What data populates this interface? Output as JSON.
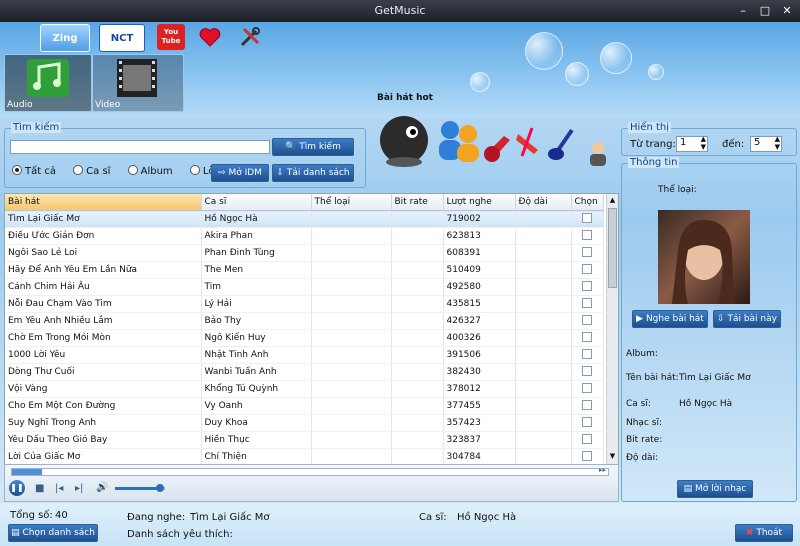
{
  "window": {
    "title": "GetMusic"
  },
  "topbar": {
    "source_tabs": [
      {
        "name": "zing",
        "label": "Zing"
      },
      {
        "name": "nct",
        "label": "NCT"
      },
      {
        "name": "youtube",
        "label": "You Tube"
      }
    ],
    "categories": [
      {
        "label": "Audio"
      },
      {
        "label": "Video"
      }
    ]
  },
  "hot": {
    "label": "Bài hát hot"
  },
  "search": {
    "group_label": "Tìm kiếm",
    "input_value": "",
    "search_button": "Tìm kiếm",
    "radios": [
      {
        "label": "Tất cả",
        "checked": true
      },
      {
        "label": "Ca sĩ",
        "checked": false
      },
      {
        "label": "Album",
        "checked": false
      },
      {
        "label": "Lời",
        "checked": false
      }
    ],
    "open_idm_button": "Mở IDM",
    "download_list_button": "Tải danh sách"
  },
  "display": {
    "group_label": "Hiển thị",
    "from_page_label": "Từ trang:",
    "from_page_value": "1",
    "to_label": "đến:",
    "to_value": "5"
  },
  "table": {
    "columns": [
      "Bài hát",
      "Ca sĩ",
      "Thể loại",
      "Bit rate",
      "Lượt nghe",
      "Độ dài",
      "Chọn"
    ],
    "rows": [
      [
        "Tìm Lại Giấc Mơ",
        "Hồ Ngọc Hà",
        "",
        "",
        "719002",
        ""
      ],
      [
        "Điều Ước Giản Đơn",
        "Akira Phan",
        "",
        "",
        "623813",
        ""
      ],
      [
        "Ngôi Sao Lẻ Loi",
        "Phan Đinh Tùng",
        "",
        "",
        "608391",
        ""
      ],
      [
        "Hãy Để Anh Yêu Em Lần Nữa",
        "The Men",
        "",
        "",
        "510409",
        ""
      ],
      [
        "Cánh Chim Hải Âu",
        "Tim",
        "",
        "",
        "492580",
        ""
      ],
      [
        "Nỗi Đau Chạm Vào Tim",
        "Lý Hải",
        "",
        "",
        "435815",
        ""
      ],
      [
        "Em Yêu Anh Nhiều Lắm",
        "Bảo Thy",
        "",
        "",
        "426327",
        ""
      ],
      [
        "Chờ Em Trong Mỏi Mòn",
        "Ngô Kiến Huy",
        "",
        "",
        "400326",
        ""
      ],
      [
        "1000 Lời Yêu",
        "Nhật Tinh Anh",
        "",
        "",
        "391506",
        ""
      ],
      [
        "Dòng Thư Cuối",
        "Wanbi Tuấn Anh",
        "",
        "",
        "382430",
        ""
      ],
      [
        "Vội Vàng",
        "Khổng Tú Quỳnh",
        "",
        "",
        "378012",
        ""
      ],
      [
        "Cho Em Một Con Đường",
        "Vy Oanh",
        "",
        "",
        "377455",
        ""
      ],
      [
        "Suy Nghĩ Trong Anh",
        "Duy Khoa",
        "",
        "",
        "357423",
        ""
      ],
      [
        "Yêu Dấu Theo Gió Bay",
        "Hiền Thục",
        "",
        "",
        "323837",
        ""
      ],
      [
        "Lời Của Giấc Mơ",
        "Chí Thiện",
        "",
        "",
        "304784",
        ""
      ]
    ]
  },
  "info": {
    "group_label": "Thông tin",
    "genre_label": "Thể loại:",
    "listen_button": "Nghe bài hát",
    "download_button": "Tải bài này",
    "album_label": "Album:",
    "song_name_label": "Tên bài hát:",
    "song_name_value": "Tìm Lại Giấc Mơ",
    "singer_label": "Ca sĩ:",
    "singer_value": "Hồ Ngọc Hà",
    "composer_label": "Nhạc sĩ:",
    "bitrate_label": "Bit rate:",
    "duration_label": "Độ dài:",
    "lyrics_button": "Mở lời nhạc"
  },
  "player": {
    "progress": 0.05,
    "volume": 0.9
  },
  "status": {
    "total_label": "Tổng số:",
    "total_value": "40",
    "choose_list_button": "Chọn danh sách",
    "playing_label": "Đang nghe:",
    "playing_value": "Tìm Lại Giấc Mơ",
    "singer_label": "Ca sĩ:",
    "singer_value": "Hồ Ngọc Hà",
    "favorites_label": "Danh sách yêu thích:",
    "exit_button": "Thoát"
  }
}
